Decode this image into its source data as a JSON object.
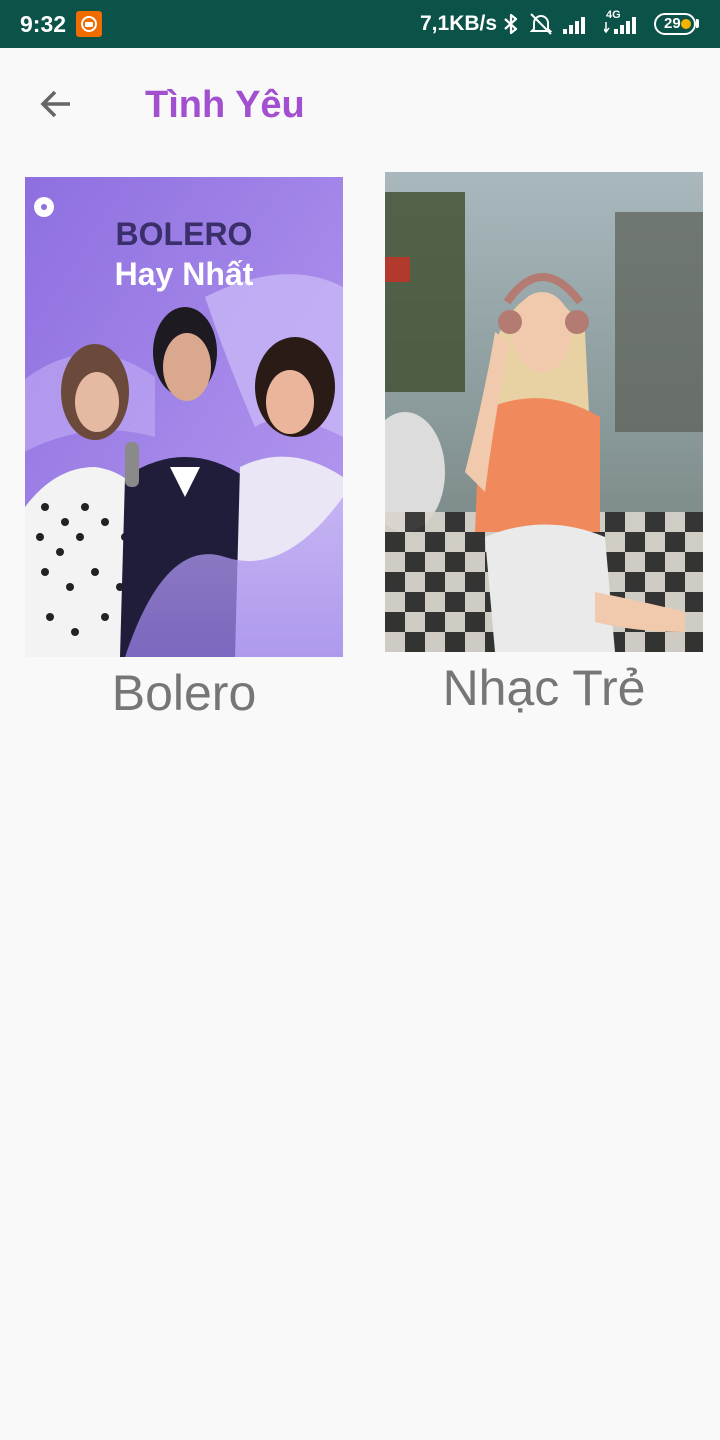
{
  "status_bar": {
    "time": "9:32",
    "network_speed": "7,1KB/s",
    "signal_label": "4G",
    "battery_level": "29"
  },
  "header": {
    "title": "Tình Yêu",
    "back_icon": "arrow-back-icon"
  },
  "colors": {
    "status_bar_bg": "#0b5348",
    "title_color": "#a24fd0",
    "background": "#f9f9f9",
    "label_color": "#767676"
  },
  "playlists": [
    {
      "label": "Bolero",
      "cover_title_line1": "BOLERO",
      "cover_title_line2": "Hay Nhất"
    },
    {
      "label": "Nhạc Trẻ"
    }
  ]
}
